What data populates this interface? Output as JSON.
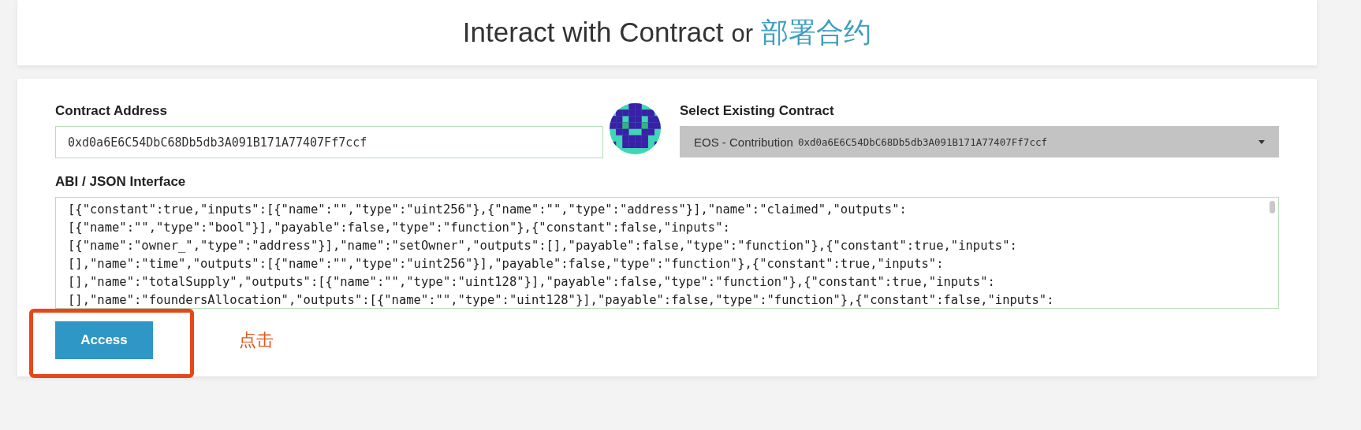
{
  "header": {
    "title": "Interact with Contract",
    "connector": "or",
    "link": "部署合约"
  },
  "contract_address": {
    "label": "Contract Address",
    "value": "0xd0a6E6C54DbC68Db5db3A091B171A77407Ff7ccf"
  },
  "select_contract": {
    "label": "Select Existing Contract",
    "value_name": "EOS - Contribution",
    "value_address": "0xd0a6E6C54DbC68Db5db3A091B171A77407Ff7ccf"
  },
  "abi": {
    "label": "ABI / JSON Interface",
    "lines": [
      "[{\"constant\":true,\"inputs\":[{\"name\":\"\",\"type\":\"uint256\"},{\"name\":\"\",\"type\":\"address\"}],\"name\":\"claimed\",\"outputs\":",
      "[{\"name\":\"\",\"type\":\"bool\"}],\"payable\":false,\"type\":\"function\"},{\"constant\":false,\"inputs\":",
      "[{\"name\":\"owner_\",\"type\":\"address\"}],\"name\":\"setOwner\",\"outputs\":[],\"payable\":false,\"type\":\"function\"},{\"constant\":true,\"inputs\":",
      "[],\"name\":\"time\",\"outputs\":[{\"name\":\"\",\"type\":\"uint256\"}],\"payable\":false,\"type\":\"function\"},{\"constant\":true,\"inputs\":",
      "[],\"name\":\"totalSupply\",\"outputs\":[{\"name\":\"\",\"type\":\"uint128\"}],\"payable\":false,\"type\":\"function\"},{\"constant\":true,\"inputs\":",
      "[],\"name\":\"foundersAllocation\",\"outputs\":[{\"name\":\"\",\"type\":\"uint128\"}],\"payable\":false,\"type\":\"function\"},{\"constant\":false,\"inputs\":"
    ]
  },
  "access_button": {
    "label": "Access"
  },
  "annotation": {
    "text": "点击"
  }
}
